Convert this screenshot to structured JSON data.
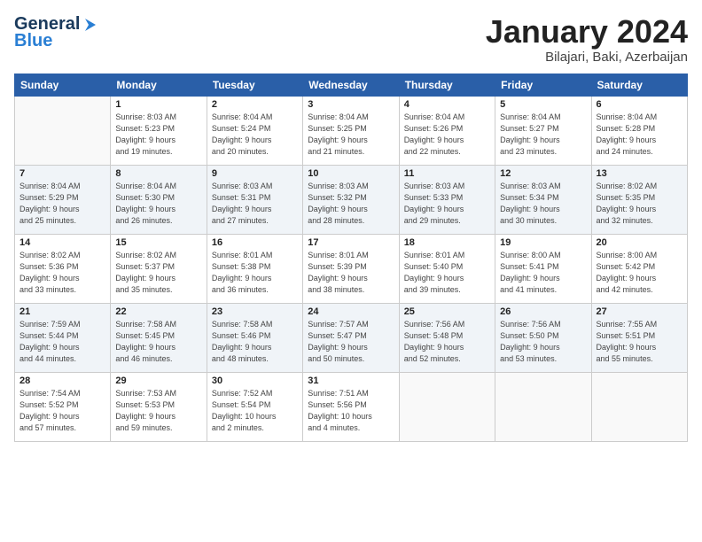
{
  "header": {
    "logo_line1": "General",
    "logo_line2": "Blue",
    "month": "January 2024",
    "location": "Bilajari, Baki, Azerbaijan"
  },
  "weekdays": [
    "Sunday",
    "Monday",
    "Tuesday",
    "Wednesday",
    "Thursday",
    "Friday",
    "Saturday"
  ],
  "weeks": [
    [
      {
        "day": "",
        "info": ""
      },
      {
        "day": "1",
        "info": "Sunrise: 8:03 AM\nSunset: 5:23 PM\nDaylight: 9 hours\nand 19 minutes."
      },
      {
        "day": "2",
        "info": "Sunrise: 8:04 AM\nSunset: 5:24 PM\nDaylight: 9 hours\nand 20 minutes."
      },
      {
        "day": "3",
        "info": "Sunrise: 8:04 AM\nSunset: 5:25 PM\nDaylight: 9 hours\nand 21 minutes."
      },
      {
        "day": "4",
        "info": "Sunrise: 8:04 AM\nSunset: 5:26 PM\nDaylight: 9 hours\nand 22 minutes."
      },
      {
        "day": "5",
        "info": "Sunrise: 8:04 AM\nSunset: 5:27 PM\nDaylight: 9 hours\nand 23 minutes."
      },
      {
        "day": "6",
        "info": "Sunrise: 8:04 AM\nSunset: 5:28 PM\nDaylight: 9 hours\nand 24 minutes."
      }
    ],
    [
      {
        "day": "7",
        "info": "Sunrise: 8:04 AM\nSunset: 5:29 PM\nDaylight: 9 hours\nand 25 minutes."
      },
      {
        "day": "8",
        "info": "Sunrise: 8:04 AM\nSunset: 5:30 PM\nDaylight: 9 hours\nand 26 minutes."
      },
      {
        "day": "9",
        "info": "Sunrise: 8:03 AM\nSunset: 5:31 PM\nDaylight: 9 hours\nand 27 minutes."
      },
      {
        "day": "10",
        "info": "Sunrise: 8:03 AM\nSunset: 5:32 PM\nDaylight: 9 hours\nand 28 minutes."
      },
      {
        "day": "11",
        "info": "Sunrise: 8:03 AM\nSunset: 5:33 PM\nDaylight: 9 hours\nand 29 minutes."
      },
      {
        "day": "12",
        "info": "Sunrise: 8:03 AM\nSunset: 5:34 PM\nDaylight: 9 hours\nand 30 minutes."
      },
      {
        "day": "13",
        "info": "Sunrise: 8:02 AM\nSunset: 5:35 PM\nDaylight: 9 hours\nand 32 minutes."
      }
    ],
    [
      {
        "day": "14",
        "info": "Sunrise: 8:02 AM\nSunset: 5:36 PM\nDaylight: 9 hours\nand 33 minutes."
      },
      {
        "day": "15",
        "info": "Sunrise: 8:02 AM\nSunset: 5:37 PM\nDaylight: 9 hours\nand 35 minutes."
      },
      {
        "day": "16",
        "info": "Sunrise: 8:01 AM\nSunset: 5:38 PM\nDaylight: 9 hours\nand 36 minutes."
      },
      {
        "day": "17",
        "info": "Sunrise: 8:01 AM\nSunset: 5:39 PM\nDaylight: 9 hours\nand 38 minutes."
      },
      {
        "day": "18",
        "info": "Sunrise: 8:01 AM\nSunset: 5:40 PM\nDaylight: 9 hours\nand 39 minutes."
      },
      {
        "day": "19",
        "info": "Sunrise: 8:00 AM\nSunset: 5:41 PM\nDaylight: 9 hours\nand 41 minutes."
      },
      {
        "day": "20",
        "info": "Sunrise: 8:00 AM\nSunset: 5:42 PM\nDaylight: 9 hours\nand 42 minutes."
      }
    ],
    [
      {
        "day": "21",
        "info": "Sunrise: 7:59 AM\nSunset: 5:44 PM\nDaylight: 9 hours\nand 44 minutes."
      },
      {
        "day": "22",
        "info": "Sunrise: 7:58 AM\nSunset: 5:45 PM\nDaylight: 9 hours\nand 46 minutes."
      },
      {
        "day": "23",
        "info": "Sunrise: 7:58 AM\nSunset: 5:46 PM\nDaylight: 9 hours\nand 48 minutes."
      },
      {
        "day": "24",
        "info": "Sunrise: 7:57 AM\nSunset: 5:47 PM\nDaylight: 9 hours\nand 50 minutes."
      },
      {
        "day": "25",
        "info": "Sunrise: 7:56 AM\nSunset: 5:48 PM\nDaylight: 9 hours\nand 52 minutes."
      },
      {
        "day": "26",
        "info": "Sunrise: 7:56 AM\nSunset: 5:50 PM\nDaylight: 9 hours\nand 53 minutes."
      },
      {
        "day": "27",
        "info": "Sunrise: 7:55 AM\nSunset: 5:51 PM\nDaylight: 9 hours\nand 55 minutes."
      }
    ],
    [
      {
        "day": "28",
        "info": "Sunrise: 7:54 AM\nSunset: 5:52 PM\nDaylight: 9 hours\nand 57 minutes."
      },
      {
        "day": "29",
        "info": "Sunrise: 7:53 AM\nSunset: 5:53 PM\nDaylight: 9 hours\nand 59 minutes."
      },
      {
        "day": "30",
        "info": "Sunrise: 7:52 AM\nSunset: 5:54 PM\nDaylight: 10 hours\nand 2 minutes."
      },
      {
        "day": "31",
        "info": "Sunrise: 7:51 AM\nSunset: 5:56 PM\nDaylight: 10 hours\nand 4 minutes."
      },
      {
        "day": "",
        "info": ""
      },
      {
        "day": "",
        "info": ""
      },
      {
        "day": "",
        "info": ""
      }
    ]
  ]
}
